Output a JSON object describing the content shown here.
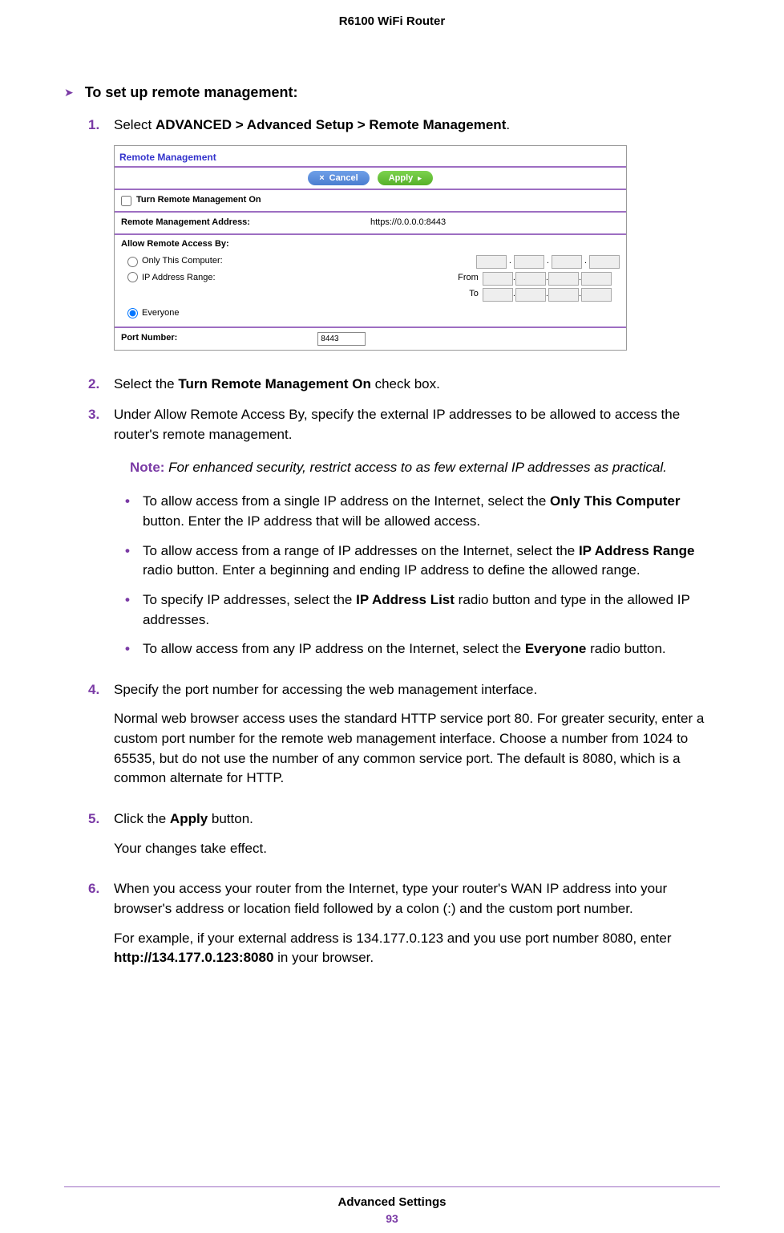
{
  "header": {
    "product": "R6100 WiFi Router"
  },
  "proc": {
    "arrow": "➤",
    "title": "To set up remote management:"
  },
  "steps": {
    "s1": {
      "num": "1.",
      "prefix": "Select ",
      "path": "ADVANCED > Advanced Setup > Remote Management",
      "suffix": "."
    },
    "s2": {
      "num": "2.",
      "prefix": "Select the ",
      "bold": "Turn Remote Management On",
      "suffix": " check box."
    },
    "s3": {
      "num": "3.",
      "text": "Under Allow Remote Access By, specify the external IP addresses to be allowed to access the router's remote management."
    },
    "s4": {
      "num": "4.",
      "line1": "Specify the port number for accessing the web management interface.",
      "line2": "Normal web browser access uses the standard HTTP service port 80. For greater security, enter a custom port number for the remote web management interface. Choose a number from 1024 to 65535, but do not use the number of any common service port. The default is 8080, which is a common alternate for HTTP."
    },
    "s5": {
      "num": "5.",
      "prefix": "Click the ",
      "bold": "Apply",
      "suffix": " button.",
      "line2": "Your changes take effect."
    },
    "s6": {
      "num": "6.",
      "line1": "When you access your router from the Internet, type your router's WAN IP address into your browser's address or location field followed by a colon (:) and the custom port number.",
      "line2a": "For example, if your external address is 134.177.0.123 and you use port number 8080, enter ",
      "bold": "http://134.177.0.123:8080",
      "line2b": " in your browser."
    }
  },
  "note": {
    "label": "Note:  ",
    "text": "For enhanced security, restrict access to as few external IP addresses as practical."
  },
  "bullets": {
    "dot": "•",
    "b1a": "To allow access from a single IP address on the Internet, select the ",
    "b1bold": "Only This Computer",
    "b1b": " button. Enter the IP address that will be allowed access.",
    "b2a": "To allow access from a range of IP addresses on the Internet, select the ",
    "b2bold": "IP Address Range",
    "b2b": " radio button. Enter a beginning and ending IP address to define the allowed range.",
    "b3a": "To specify IP addresses, select the ",
    "b3bold": "IP Address List",
    "b3b": " radio button and type in the allowed IP addresses.",
    "b4a": "To allow access from any IP address on the Internet, select the ",
    "b4bold": "Everyone",
    "b4b": " radio button."
  },
  "panel": {
    "title": "Remote Management",
    "cancel": "Cancel",
    "apply": "Apply",
    "turn_on": "Turn Remote Management On",
    "addr_label": "Remote Management Address:",
    "addr_value": "https://0.0.0.0:8443",
    "allow_label": "Allow Remote Access By:",
    "only_this": "Only This Computer:",
    "ip_range": "IP Address Range:",
    "from": "From",
    "to": "To",
    "everyone": "Everyone",
    "port_label": "Port Number:",
    "port_value": "8443"
  },
  "footer": {
    "title": "Advanced Settings",
    "page": "93"
  }
}
